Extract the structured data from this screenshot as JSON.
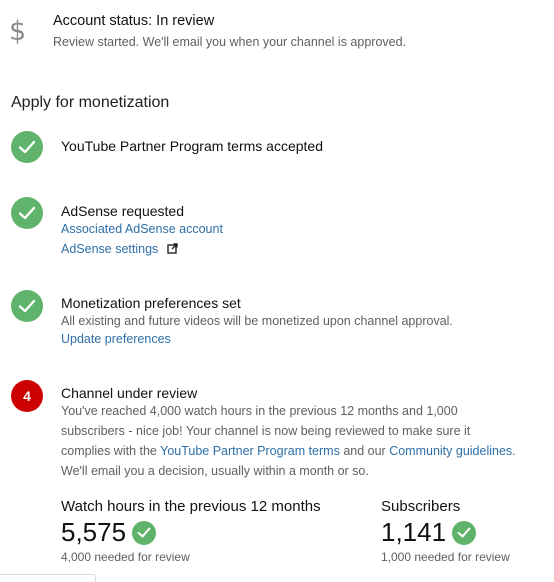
{
  "account_status": {
    "icon": "dollar-icon",
    "title": "Account status: In review",
    "subtitle": "Review started. We'll email you when your channel is approved."
  },
  "section_heading": "Apply for monetization",
  "steps": [
    {
      "state": "done",
      "icon": "check-icon",
      "title": "YouTube Partner Program terms accepted"
    },
    {
      "state": "done",
      "icon": "check-icon",
      "title": "AdSense requested",
      "links": [
        "Associated AdSense account",
        "AdSense settings"
      ],
      "link_icon": "external-link-icon"
    },
    {
      "state": "done",
      "icon": "check-icon",
      "title": "Monetization preferences set",
      "description": "All existing and future videos will be monetized upon channel approval.",
      "link": "Update preferences"
    },
    {
      "state": "current",
      "number": "4",
      "title": "Channel under review",
      "description": {
        "line1": "You've reached 4,000 watch hours in the previous 12 months and 1,000",
        "line2": "subscribers - nice job! Your channel is now being reviewed to make sure it",
        "line3_prefix": "complies with the ",
        "link_terms": "YouTube Partner Program terms",
        "line3_mid": " and our ",
        "link_guidelines": "Community guidelines",
        "line3_suffix": ".",
        "line4": "We'll email you a decision, usually within a month or so."
      }
    }
  ],
  "stats": {
    "watch_hours": {
      "label": "Watch hours in the previous 12 months",
      "value": "5,575",
      "note": "4,000 needed for review",
      "icon": "check-icon"
    },
    "subscribers": {
      "label": "Subscribers",
      "value": "1,141",
      "note": "1,000 needed for review",
      "icon": "check-icon"
    }
  },
  "colors": {
    "success": "#5fb36a",
    "current_step": "#cc0000",
    "link": "#2e6fa8",
    "secondary_text": "#606060"
  }
}
